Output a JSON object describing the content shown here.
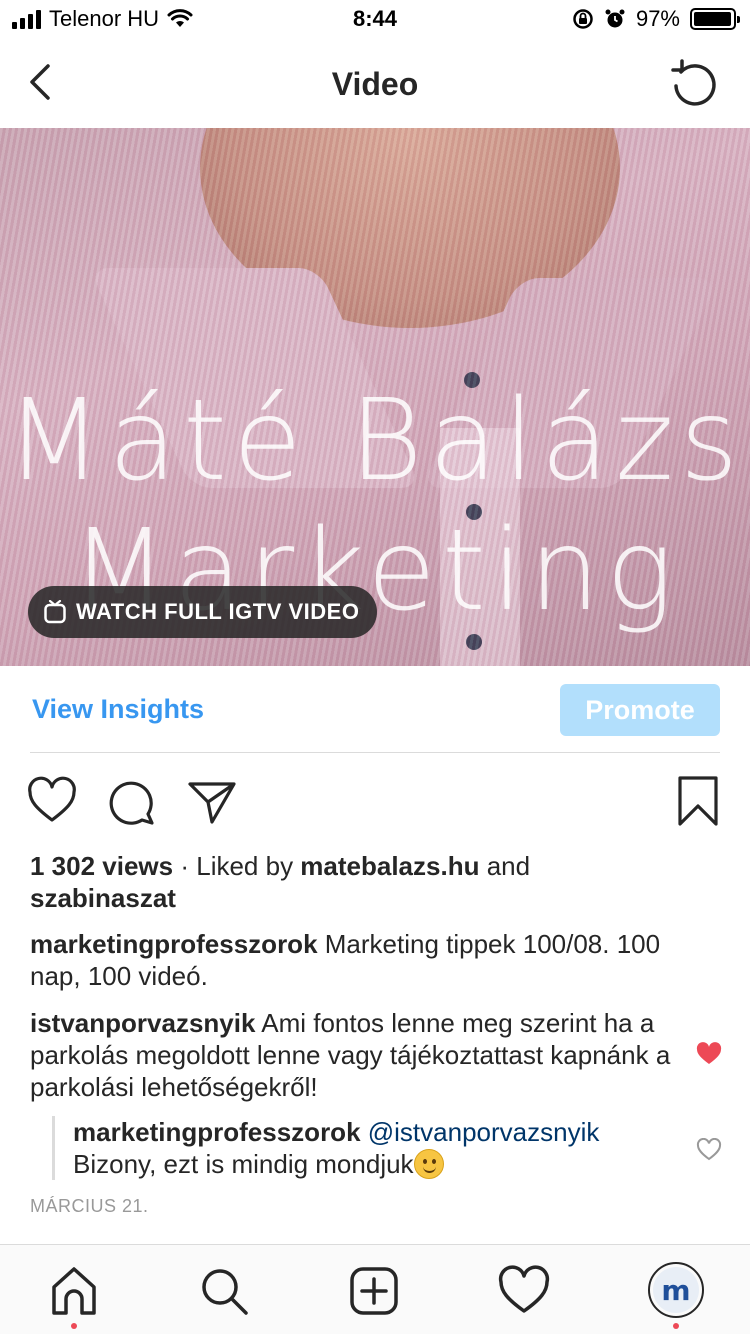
{
  "status_bar": {
    "carrier": "Telenor HU",
    "time": "8:44",
    "battery_percent": "97%",
    "battery_level": 0.97
  },
  "nav": {
    "title": "Video",
    "back_icon": "chevron-left-icon",
    "refresh_icon": "refresh-icon"
  },
  "video": {
    "overlay_line1": "Máté Balázs",
    "overlay_line2": "Marketing",
    "igtv_label": "WATCH FULL IGTV VIDEO"
  },
  "insights": {
    "view_insights_label": "View Insights",
    "promote_label": "Promote"
  },
  "post": {
    "views": "1 302 views",
    "liked_by_prefix": " · Liked by ",
    "liked_by_user1": "matebalazs.hu",
    "liked_by_and": " and",
    "liked_by_user2": "szabinaszat",
    "caption_user": "marketingprofesszorok",
    "caption_text": " Marketing tippek 100/08. 100 nap, 100 videó.",
    "comment_user": "istvanporvazsnyik",
    "comment_text": " Ami fontos lenne meg szerint ha a parkolás megoldott lenne vagy tájékoztattast kapnánk  a parkolási lehetőségekről!",
    "reply_user": "marketingprofesszorok",
    "reply_mention": "@istvanporvazsnyik",
    "reply_text": "Bizony, ezt is mindig mondjuk",
    "date": "MÁRCIUS 21."
  },
  "colors": {
    "accent_blue": "#3897f0",
    "promote_bg": "#b2dffc",
    "like_red": "#ed4956"
  },
  "tab_bar": {
    "items": [
      "home-icon",
      "search-icon",
      "new-post-icon",
      "activity-icon",
      "profile-avatar"
    ],
    "avatar_letter": "m"
  }
}
